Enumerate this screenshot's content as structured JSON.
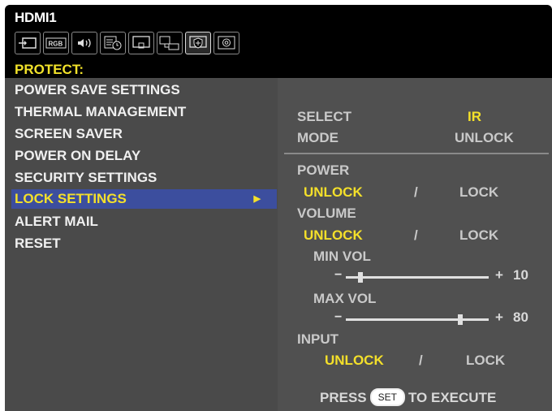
{
  "header": {
    "title": "HDMI1"
  },
  "toolbar": {
    "icons": [
      "input-icon",
      "rgb-icon",
      "audio-icon",
      "schedule-icon",
      "screen-icon",
      "multi-input-icon",
      "protect-icon",
      "setup-icon"
    ],
    "selected": "protect-icon"
  },
  "menu": {
    "heading": "PROTECT:",
    "items": [
      "POWER SAVE SETTINGS",
      "THERMAL MANAGEMENT",
      "SCREEN SAVER",
      "POWER ON DELAY",
      "SECURITY SETTINGS",
      "LOCK SETTINGS",
      "ALERT MAIL",
      "RESET"
    ],
    "selected": "LOCK SETTINGS",
    "arrow": "▶"
  },
  "panel": {
    "select": {
      "label": "SELECT",
      "value": "IR"
    },
    "mode": {
      "label": "MODE",
      "value": "UNLOCK"
    },
    "power": {
      "label": "POWER",
      "unlock": "UNLOCK",
      "sep": "/",
      "lock": "LOCK",
      "selected": "UNLOCK"
    },
    "volume": {
      "label": "VOLUME",
      "unlock": "UNLOCK",
      "sep": "/",
      "lock": "LOCK",
      "selected": "UNLOCK"
    },
    "min_vol": {
      "label": "MIN VOL",
      "minus": "−",
      "plus": "+",
      "value": "10",
      "level": 0.1
    },
    "max_vol": {
      "label": "MAX VOL",
      "minus": "−",
      "plus": "+",
      "value": "80",
      "level": 0.8
    },
    "input": {
      "label": "INPUT",
      "unlock": "UNLOCK",
      "sep": "/",
      "lock": "LOCK",
      "selected": "UNLOCK"
    },
    "footer": {
      "press": "PRESS",
      "set": "SET",
      "execute": "TO EXECUTE"
    }
  }
}
